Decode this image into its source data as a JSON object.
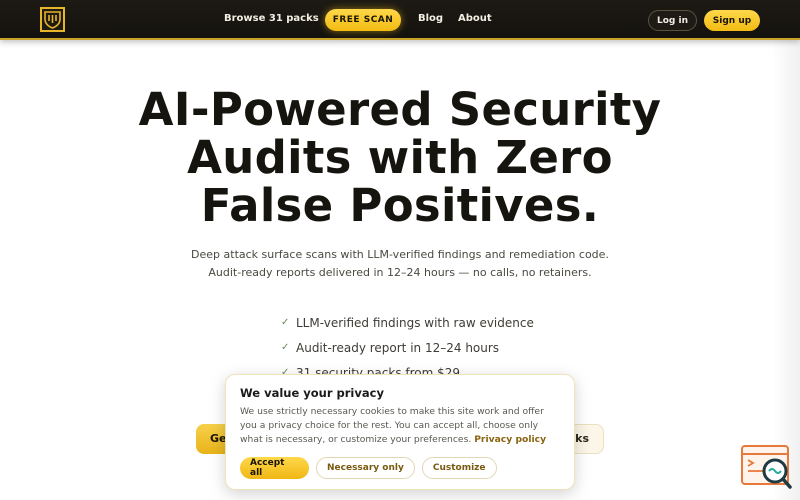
{
  "header": {
    "nav": {
      "browse": "Browse 31 packs",
      "free_scan": "FREE SCAN",
      "blog": "Blog",
      "about": "About"
    },
    "login": "Log in",
    "signup": "Sign up"
  },
  "hero": {
    "title_lines": [
      "AI-Powered Security",
      "Audits with Zero",
      "False Positives."
    ],
    "subtitle_lines": [
      "Deep attack surface scans with LLM-verified findings and remediation code.",
      "Audit-ready reports delivered in 12–24 hours — no calls, no retainers."
    ],
    "features": [
      "LLM-verified findings with raw evidence",
      "Audit-ready report in 12–24 hours",
      "31 security packs from $29"
    ],
    "cta_left_visible": "Ge",
    "cta_right_visible": "cks"
  },
  "cookie_banner": {
    "title": "We value your privacy",
    "text": "We use strictly necessary cookies to make this site work and offer you a privacy choice for the rest. You can accept all, choose only what is necessary, or customize your preferences.",
    "link": "Privacy policy",
    "accept_all": "Accept all",
    "necessary_only": "Necessary only",
    "customize": "Customize"
  },
  "icons": {
    "logo": "shield-logo-icon",
    "check": "check-icon",
    "widget": "search-report-icon"
  },
  "colors": {
    "accent": "#f2bb12",
    "header_bg": "#1d1a14",
    "widget": "#e8793a"
  }
}
